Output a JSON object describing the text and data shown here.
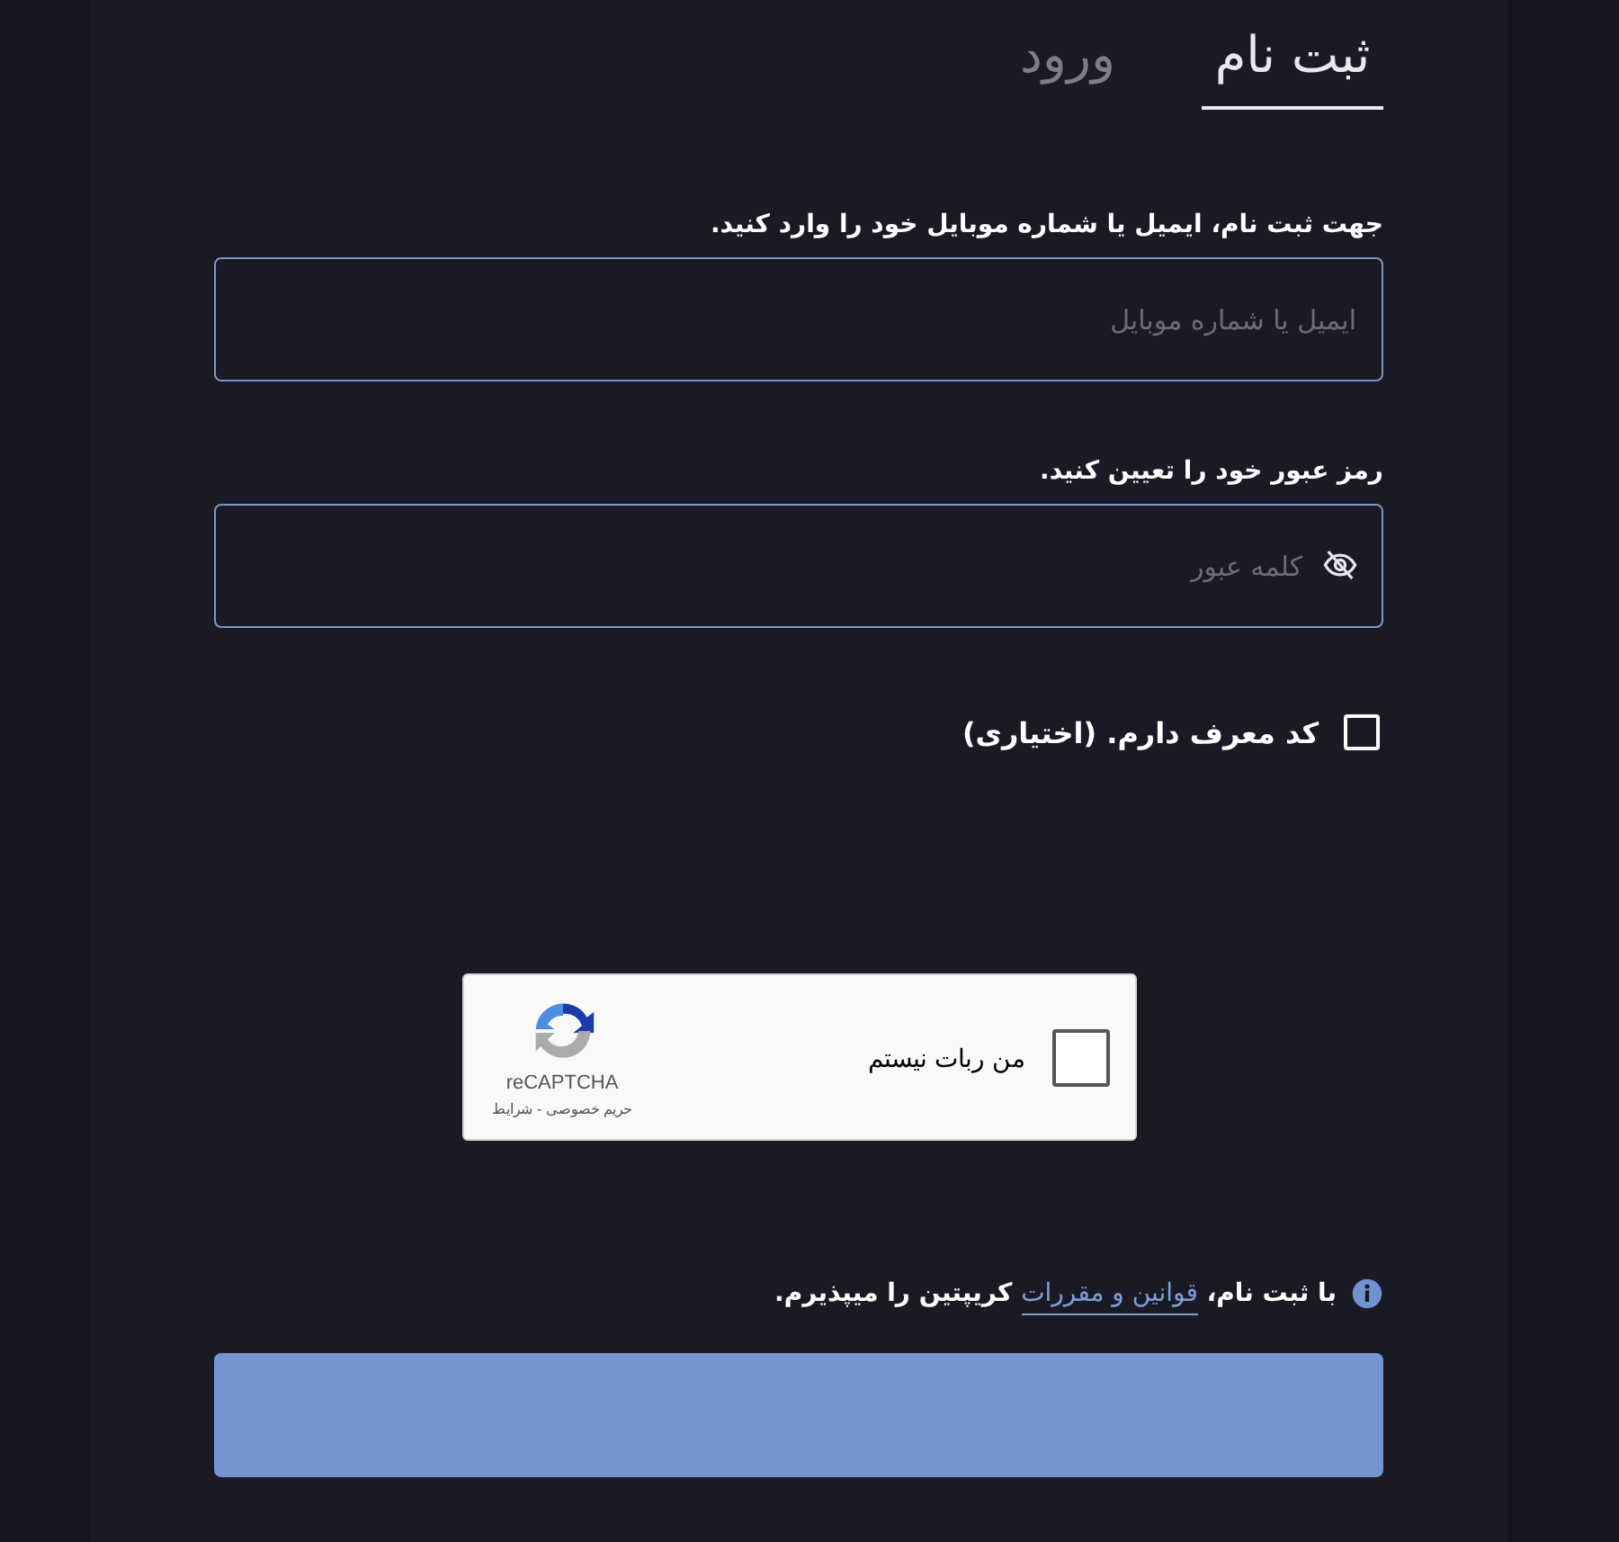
{
  "tabs": [
    {
      "label": "ثبت نام",
      "selected": true
    },
    {
      "label": "ورود",
      "selected": false
    }
  ],
  "fields": [
    {
      "label": "جهت ثبت نام، ایمیل یا شماره موبایل خود را وارد کنید.",
      "placeholder": "ایمیل یا شماره موبایل",
      "kind": "text"
    },
    {
      "label": "رمز عبور خود را تعیین کنید.",
      "placeholder": "کلمه عبور",
      "kind": "password"
    }
  ],
  "referral": {
    "label": "کد معرف دارم. (اختیاری)",
    "checked": false
  },
  "captcha": {
    "label": "من ربات نیستم",
    "checked": false,
    "brand": "reCAPTCHA",
    "links": "حریم خصوصی - شرایط"
  },
  "terms": {
    "before": "با ثبت نام،",
    "link": "قوانین و مقررات",
    "after": "کریپتین را میپذیرم."
  },
  "submit": {
    "disabled": true
  }
}
